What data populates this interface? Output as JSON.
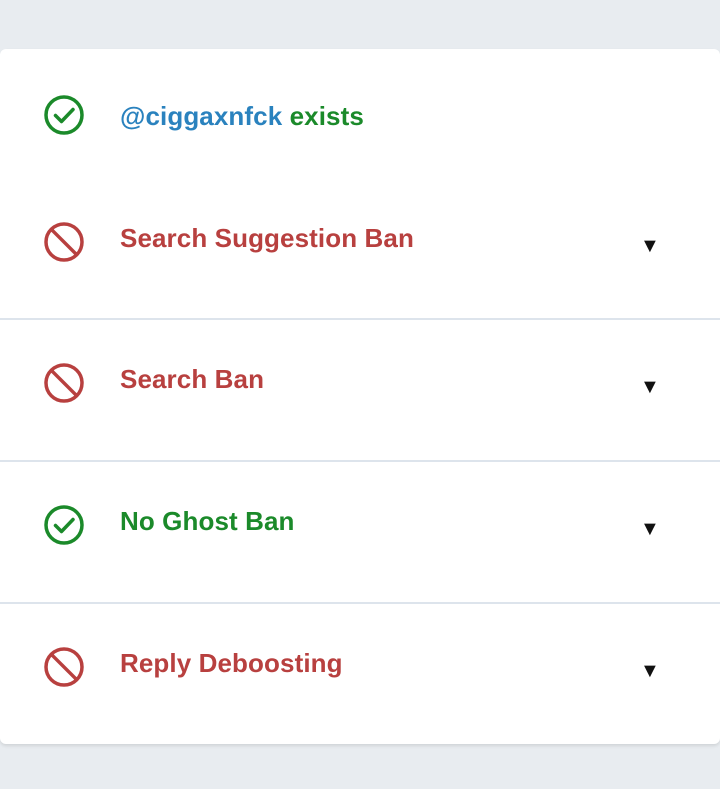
{
  "results": {
    "exists": {
      "handle": "@ciggaxnfck",
      "text": " exists",
      "icon": "check-circle-icon",
      "status": "ok",
      "color": "#1b8a2a"
    },
    "items": [
      {
        "label": "Search Suggestion Ban",
        "icon": "ban-icon",
        "status": "bad",
        "color": "#b8403f",
        "toggle": "▼"
      },
      {
        "label": "Search Ban",
        "icon": "ban-icon",
        "status": "bad",
        "color": "#b8403f",
        "toggle": "▼"
      },
      {
        "label": "No Ghost Ban",
        "icon": "check-circle-icon",
        "status": "ok",
        "color": "#1b8a2a",
        "toggle": "▼"
      },
      {
        "label": "Reply Deboosting",
        "icon": "ban-icon",
        "status": "bad",
        "color": "#b8403f",
        "toggle": "▼"
      }
    ]
  },
  "colors": {
    "handle": "#2a82be",
    "background": "#e8ecf0",
    "card": "#ffffff",
    "divider": "#dde4ec"
  }
}
